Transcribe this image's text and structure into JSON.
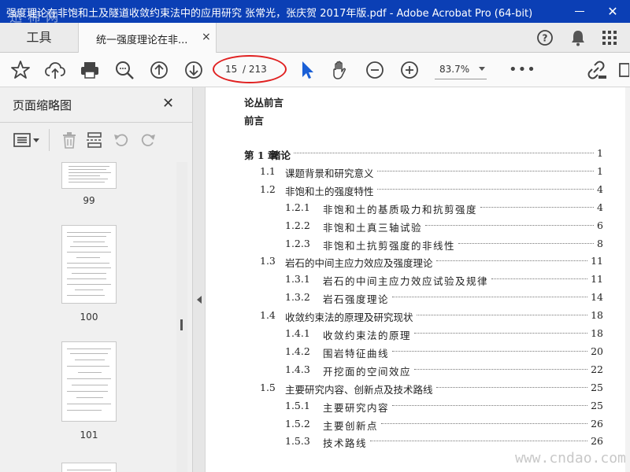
{
  "window": {
    "title": "强度理论在非饱和土及隧道收敛约束法中的应用研究 张常光，张庆贺 2017年版.pdf - Adobe Acrobat Pro (64-bit)",
    "close_label": "✕",
    "watermark_top": "迅 棉 网"
  },
  "tabs": {
    "tools_label": "工具",
    "doc_label": "统一强度理论在非...",
    "doc_close": "×"
  },
  "toolbar": {
    "page_current": "15",
    "page_total": "/ 213",
    "zoom": "83.7%",
    "more": "•••"
  },
  "sidepanel": {
    "title": "页面缩略图",
    "close": "✕",
    "thumbnails": [
      {
        "label": "99"
      },
      {
        "label": "100"
      },
      {
        "label": "101"
      }
    ]
  },
  "document": {
    "headers": [
      "论丛前言",
      "前言"
    ],
    "toc": [
      {
        "num": "第 1 章",
        "title": "绪论",
        "page": "1",
        "level": 0
      },
      {
        "num": "1.1",
        "title": "课题背景和研究意义",
        "page": "1",
        "level": 1
      },
      {
        "num": "1.2",
        "title": "非饱和土的强度特性",
        "page": "4",
        "level": 1
      },
      {
        "num": "1.2.1",
        "title": "非饱和土的基质吸力和抗剪强度",
        "page": "4",
        "level": 2
      },
      {
        "num": "1.2.2",
        "title": "非饱和土真三轴试验",
        "page": "6",
        "level": 2
      },
      {
        "num": "1.2.3",
        "title": "非饱和土抗剪强度的非线性",
        "page": "8",
        "level": 2
      },
      {
        "num": "1.3",
        "title": "岩石的中间主应力效应及强度理论",
        "page": "11",
        "level": 1
      },
      {
        "num": "1.3.1",
        "title": "岩石的中间主应力效应试验及规律",
        "page": "11",
        "level": 2
      },
      {
        "num": "1.3.2",
        "title": "岩石强度理论",
        "page": "14",
        "level": 2
      },
      {
        "num": "1.4",
        "title": "收敛约束法的原理及研究现状",
        "page": "18",
        "level": 1
      },
      {
        "num": "1.4.1",
        "title": "收敛约束法的原理",
        "page": "18",
        "level": 2
      },
      {
        "num": "1.4.2",
        "title": "围岩特征曲线",
        "page": "20",
        "level": 2
      },
      {
        "num": "1.4.3",
        "title": "开挖面的空间效应",
        "page": "22",
        "level": 2
      },
      {
        "num": "1.5",
        "title": "主要研究内容、创新点及技术路线",
        "page": "25",
        "level": 1
      },
      {
        "num": "1.5.1",
        "title": "主要研究内容",
        "page": "25",
        "level": 2
      },
      {
        "num": "1.5.2",
        "title": "主要创新点",
        "page": "26",
        "level": 2
      },
      {
        "num": "1.5.3",
        "title": "技术路线",
        "page": "26",
        "level": 2
      }
    ]
  },
  "watermark_bottom": "www.cndao.com",
  "colors": {
    "titlebar": "#0b3fb5",
    "annotation_oval": "#e02020",
    "select_arrow": "#1a5fd6"
  }
}
